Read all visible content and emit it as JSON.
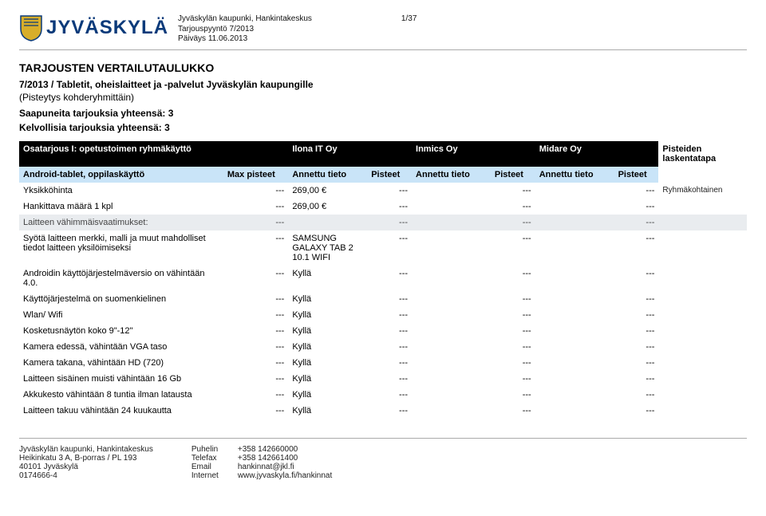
{
  "header": {
    "org": "Jyväskylän kaupunki, Hankintakeskus",
    "req": "Tarjouspyyntö 7/2013",
    "date": "Päiväys 11.06.2013",
    "page": "1/37",
    "brand": "JYVÄSKYLÄ"
  },
  "titles": {
    "main": "TARJOUSTEN VERTAILUTAULUKKO",
    "sub_bold": "7/2013 / Tabletit, oheislaitteet ja -palvelut Jyväskylän kaupungille",
    "sub_plain": "(Pisteytys kohderyhmittäin)",
    "recv": "Saapuneita tarjouksia yhteensä: 3",
    "valid": "Kelvollisia tarjouksia yhteensä: 3"
  },
  "th1": {
    "group": "Osatarjous I: opetustoimen ryhmäkäyttö",
    "v1": "Ilona IT Oy",
    "v2": "Inmics Oy",
    "v3": "Midare Oy",
    "calc": "Pisteiden laskentatapa"
  },
  "th2": {
    "prod": "Android-tablet, oppilaskäyttö",
    "max": "Max pisteet",
    "ann": "Annettu tieto",
    "pts": "Pisteet"
  },
  "rows": [
    {
      "label": "Yksikköhinta",
      "max": "---",
      "v1a": "269,00 €",
      "v1p": "---",
      "v2a": "",
      "v2p": "---",
      "v3a": "",
      "v3p": "---",
      "note": "Ryhmäkohtainen"
    },
    {
      "label": "Hankittava määrä 1 kpl",
      "max": "---",
      "v1a": "269,00 €",
      "v1p": "---",
      "v2a": "",
      "v2p": "---",
      "v3a": "",
      "v3p": "---",
      "note": ""
    },
    {
      "section": true,
      "label": "Laitteen vähimmäisvaatimukset:",
      "max": "---",
      "v1a": "",
      "v1p": "---",
      "v2a": "",
      "v2p": "---",
      "v3a": "",
      "v3p": "---",
      "note": ""
    },
    {
      "label": "Syötä laitteen merkki, malli ja muut mahdolliset tiedot laitteen yksilöimiseksi",
      "max": "---",
      "v1a": "SAMSUNG GALAXY TAB 2 10.1 WIFI",
      "v1p": "---",
      "v2a": "",
      "v2p": "---",
      "v3a": "",
      "v3p": "---",
      "note": ""
    },
    {
      "label": "Androidin käyttöjärjestelmäversio on vähintään 4.0.",
      "max": "---",
      "v1a": "Kyllä",
      "v1p": "---",
      "v2a": "",
      "v2p": "---",
      "v3a": "",
      "v3p": "---",
      "note": ""
    },
    {
      "label": "Käyttöjärjestelmä on suomenkielinen",
      "max": "---",
      "v1a": "Kyllä",
      "v1p": "---",
      "v2a": "",
      "v2p": "---",
      "v3a": "",
      "v3p": "---",
      "note": ""
    },
    {
      "label": "Wlan/ Wifi",
      "max": "---",
      "v1a": "Kyllä",
      "v1p": "---",
      "v2a": "",
      "v2p": "---",
      "v3a": "",
      "v3p": "---",
      "note": ""
    },
    {
      "label": "Kosketusnäytön koko 9\"-12\"",
      "max": "---",
      "v1a": "Kyllä",
      "v1p": "---",
      "v2a": "",
      "v2p": "---",
      "v3a": "",
      "v3p": "---",
      "note": ""
    },
    {
      "label": "Kamera edessä, vähintään VGA taso",
      "max": "---",
      "v1a": "Kyllä",
      "v1p": "---",
      "v2a": "",
      "v2p": "---",
      "v3a": "",
      "v3p": "---",
      "note": ""
    },
    {
      "label": "Kamera takana, vähintään HD (720)",
      "max": "---",
      "v1a": "Kyllä",
      "v1p": "---",
      "v2a": "",
      "v2p": "---",
      "v3a": "",
      "v3p": "---",
      "note": ""
    },
    {
      "label": "Laitteen sisäinen muisti vähintään 16 Gb",
      "max": "---",
      "v1a": "Kyllä",
      "v1p": "---",
      "v2a": "",
      "v2p": "---",
      "v3a": "",
      "v3p": "---",
      "note": ""
    },
    {
      "label": "Akkukesto vähintään 8 tuntia ilman latausta",
      "max": "---",
      "v1a": "Kyllä",
      "v1p": "---",
      "v2a": "",
      "v2p": "---",
      "v3a": "",
      "v3p": "---",
      "note": ""
    },
    {
      "label": "Laitteen takuu vähintään 24 kuukautta",
      "max": "---",
      "v1a": "Kyllä",
      "v1p": "---",
      "v2a": "",
      "v2p": "---",
      "v3a": "",
      "v3p": "---",
      "note": ""
    }
  ],
  "footer": {
    "addr": [
      "Jyväskylän kaupunki, Hankintakeskus",
      "Heikinkatu 3 A, B-porras / PL 193",
      "40101 Jyväskylä",
      "0174666-4"
    ],
    "contacts": [
      {
        "k": "Puhelin",
        "v": "+358 142660000"
      },
      {
        "k": "Telefax",
        "v": "+358 142661400"
      },
      {
        "k": "Email",
        "v": "hankinnat@jkl.fi"
      },
      {
        "k": "Internet",
        "v": "www.jyvaskyla.fi/hankinnat"
      }
    ]
  }
}
